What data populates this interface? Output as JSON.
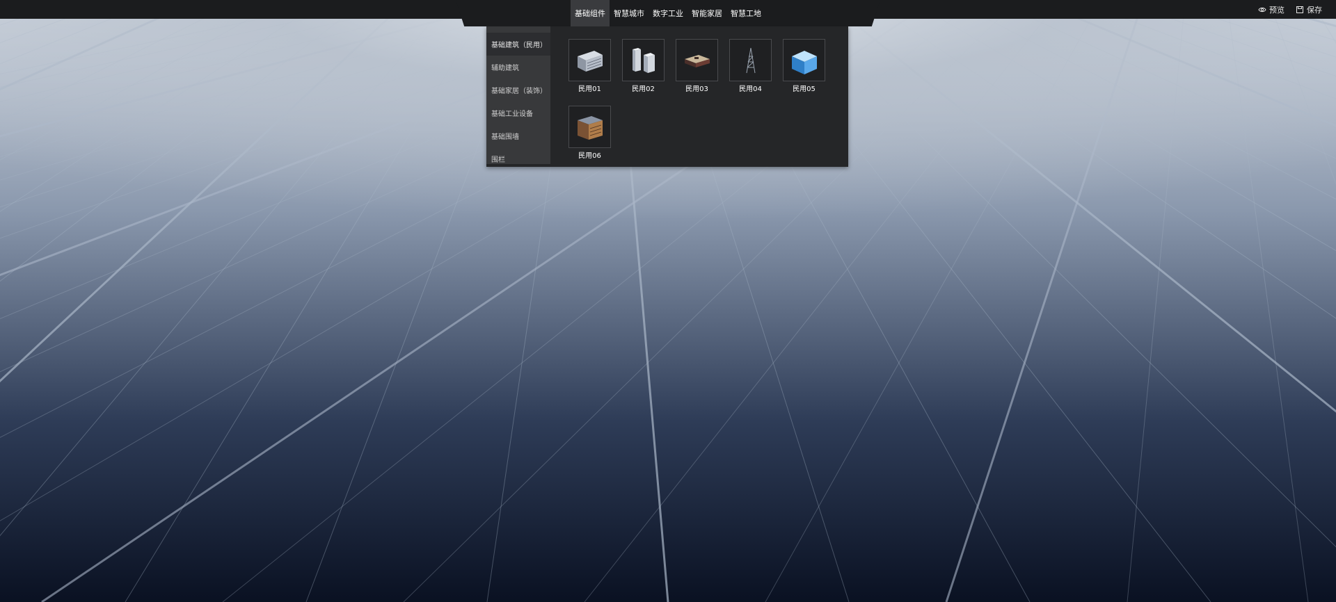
{
  "header": {
    "tabs": [
      {
        "label": "基础组件",
        "active": true
      },
      {
        "label": "智慧城市",
        "active": false
      },
      {
        "label": "数字工业",
        "active": false
      },
      {
        "label": "智能家居",
        "active": false
      },
      {
        "label": "智慧工地",
        "active": false
      }
    ],
    "actions": {
      "preview_label": "预览",
      "save_label": "保存"
    }
  },
  "panel": {
    "categories": [
      {
        "label": "基础建筑（民用）",
        "active": true
      },
      {
        "label": "辅助建筑",
        "active": false
      },
      {
        "label": "基础家居（装饰）",
        "active": false
      },
      {
        "label": "基础工业设备",
        "active": false
      },
      {
        "label": "基础围墙",
        "active": false
      },
      {
        "label": "围栏",
        "active": false
      }
    ],
    "items": [
      {
        "label": "民用01",
        "icon": "office-building-icon"
      },
      {
        "label": "民用02",
        "icon": "twin-towers-icon"
      },
      {
        "label": "民用03",
        "icon": "flat-building-icon"
      },
      {
        "label": "民用04",
        "icon": "signal-tower-icon"
      },
      {
        "label": "民用05",
        "icon": "blue-cube-building-icon"
      },
      {
        "label": "民用06",
        "icon": "brick-building-icon"
      }
    ]
  },
  "colors": {
    "topbar": "#1b1c1e",
    "panel": "#252628",
    "sidebar": "#38393b",
    "active_tab": "#3a3b3e"
  }
}
